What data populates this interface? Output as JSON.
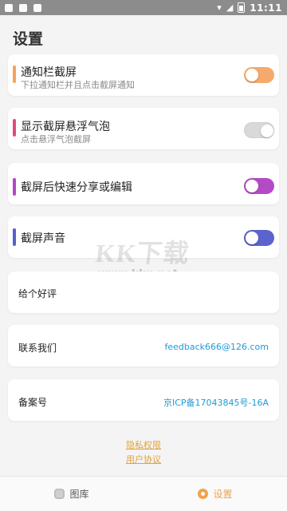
{
  "status_bar": {
    "time": "11:11",
    "icons": [
      "notification-icon",
      "image-icon",
      "app-icon"
    ]
  },
  "page": {
    "title": "设置"
  },
  "settings": [
    {
      "title": "通知栏截屏",
      "subtitle": "下拉通知栏并且点击截屏通知",
      "accent_color": "#f5a45a",
      "toggle_on": false,
      "toggle_color": "#f6a96a"
    },
    {
      "title": "显示截屏悬浮气泡",
      "subtitle": "点击悬浮气泡截屏",
      "accent_color": "#e04b7a",
      "toggle_on": true,
      "toggle_color": "#d9d9d9"
    },
    {
      "title": "截屏后快速分享或编辑",
      "subtitle": "",
      "accent_color": "#b247c4",
      "toggle_on": false,
      "toggle_color": "#b44ac6"
    },
    {
      "title": "截屏声音",
      "subtitle": "",
      "accent_color": "#5660c9",
      "toggle_on": false,
      "toggle_color": "#5b63cf"
    }
  ],
  "rows": {
    "rate": {
      "label": "给个好评"
    },
    "contact": {
      "label": "联系我们",
      "value": "feedback666@126.com"
    },
    "icp": {
      "label": "备案号",
      "value": "京ICP备17043845号-16A"
    }
  },
  "links": {
    "privacy": "隐私权限",
    "agreement": "用户协议"
  },
  "bottom_nav": {
    "gallery": "图库",
    "settings": "设置",
    "active_color": "#f2a24a"
  },
  "watermark": {
    "text": "KK下载",
    "url": "www.kkx.net"
  }
}
